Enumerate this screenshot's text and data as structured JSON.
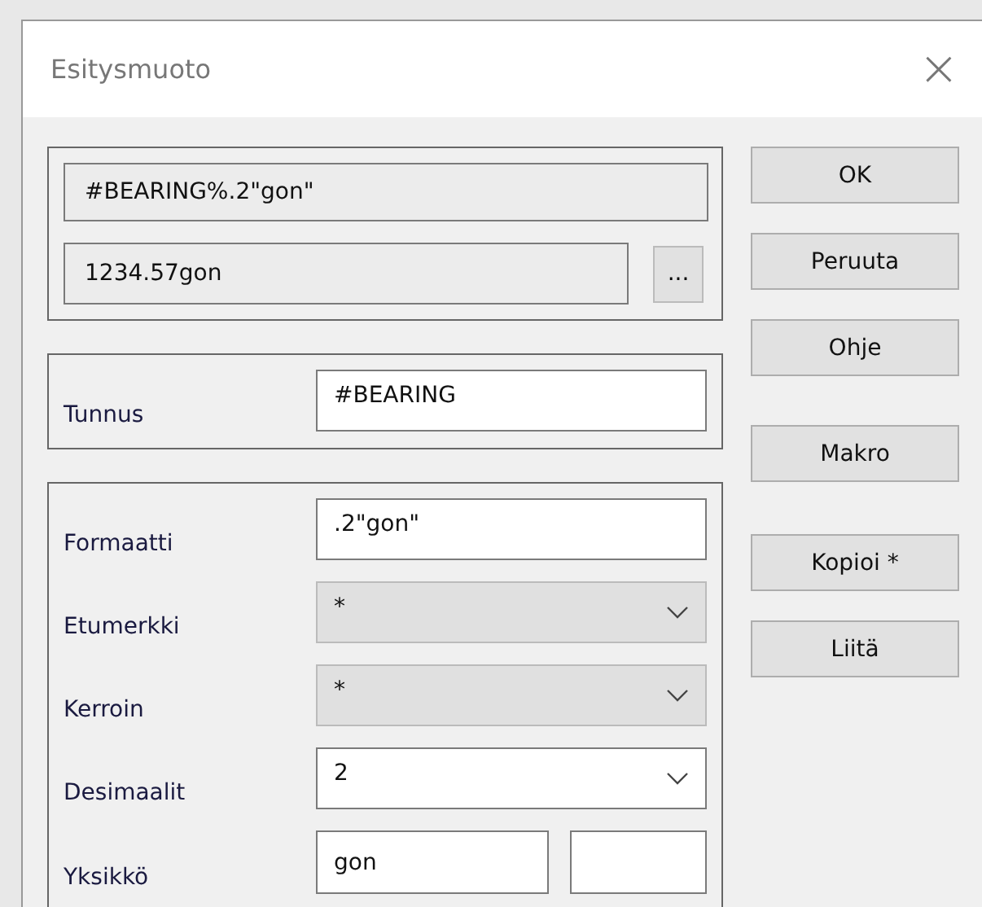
{
  "window": {
    "title": "Esitysmuoto",
    "close": "×"
  },
  "preview": {
    "format": {
      "value": "#BEARING%.2\"gon\"",
      "disabled": true
    },
    "result": {
      "value": "1234.57gon",
      "disabled": true
    },
    "browse": "..."
  },
  "identifier": {
    "label": "Tunnus",
    "value": "#BEARING"
  },
  "fields": [
    {
      "kind": "text",
      "label": "Formaatti",
      "value": ".2\"gon\"",
      "disabled": false
    },
    {
      "kind": "combo",
      "label": "Etumerkki",
      "value": "*",
      "disabled": true
    },
    {
      "kind": "combo",
      "label": "Kerroin",
      "value": "*",
      "disabled": true
    },
    {
      "kind": "combo",
      "label": "Desimaalit",
      "value": "2",
      "disabled": false
    },
    {
      "kind": "pair",
      "label": "Yksikkö",
      "value": "gon",
      "disabled": false
    }
  ],
  "buttons": [
    "OK",
    "Peruuta",
    "Ohje",
    "Makro",
    "Kopioi *",
    "Liitä"
  ]
}
